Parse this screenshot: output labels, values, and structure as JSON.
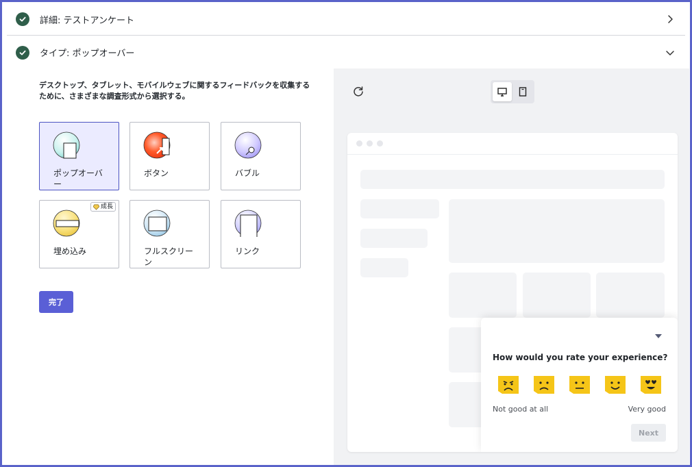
{
  "sections": [
    {
      "title": "詳細: テストアンケート",
      "state": "collapsed"
    },
    {
      "title": "タイプ: ポップオーバー",
      "state": "expanded"
    }
  ],
  "description": "デスクトップ、タブレット、モバイルウェブに関するフィードバックを収集するために、さまざまな調査形式から選択する。",
  "types": [
    {
      "label": "ポップオーバー",
      "selected": true
    },
    {
      "label": "ボタン",
      "selected": false
    },
    {
      "label": "バブル",
      "selected": false
    },
    {
      "label": "埋め込み",
      "selected": false,
      "badge": "成長"
    },
    {
      "label": "フルスクリーン",
      "selected": false
    },
    {
      "label": "リンク",
      "selected": false
    }
  ],
  "done_label": "完了",
  "preview": {
    "device": "desktop",
    "question": "How would you rate your experience?",
    "scale_low": "Not good at all",
    "scale_high": "Very good",
    "next_label": "Next"
  },
  "colors": {
    "accent": "#5a5fd6",
    "check": "#2f5e4a",
    "emoji": "#f5c518"
  }
}
